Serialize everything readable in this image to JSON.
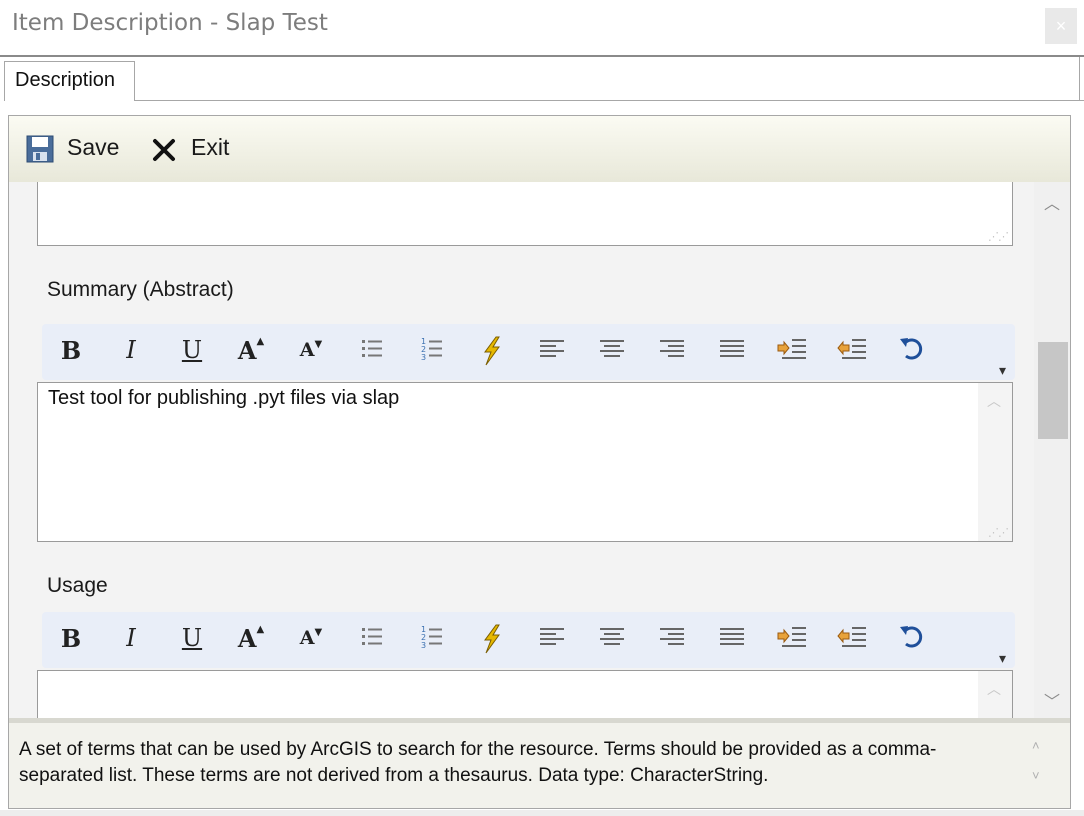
{
  "window": {
    "title": "Item Description - Slap Test",
    "close_glyph": "×"
  },
  "tabs": [
    {
      "label": "Description"
    }
  ],
  "toolbar": {
    "save_label": "Save",
    "exit_label": "Exit"
  },
  "sections": {
    "summary": {
      "label": "Summary (Abstract)",
      "value": "Test tool for publishing .pyt files via slap"
    },
    "usage": {
      "label": "Usage",
      "value": ""
    }
  },
  "format_toolbar": {
    "items": [
      {
        "name": "bold",
        "glyph": "B"
      },
      {
        "name": "italic",
        "glyph": "I"
      },
      {
        "name": "underline",
        "glyph": "U"
      },
      {
        "name": "grow-font",
        "glyph": "A"
      },
      {
        "name": "shrink-font",
        "glyph": "A"
      },
      {
        "name": "bullet-list",
        "glyph": ""
      },
      {
        "name": "numbered-list",
        "glyph": ""
      },
      {
        "name": "clear-format",
        "glyph": ""
      },
      {
        "name": "align-left",
        "glyph": ""
      },
      {
        "name": "align-center",
        "glyph": ""
      },
      {
        "name": "align-right",
        "glyph": ""
      },
      {
        "name": "justify",
        "glyph": ""
      },
      {
        "name": "indent",
        "glyph": ""
      },
      {
        "name": "outdent",
        "glyph": ""
      },
      {
        "name": "undo",
        "glyph": ""
      }
    ],
    "more_glyph": "▾"
  },
  "help": {
    "text": "A set of terms that can be used by ArcGIS to search for the resource. Terms should be provided as a comma-separated list. These terms are not derived from a thesaurus. Data type: CharacterString."
  },
  "colors": {
    "toolbar_bg": "#efefe2",
    "format_bar_bg": "#e9eef8",
    "lightning": "#e6b800",
    "arrow_orange": "#e8a23a"
  }
}
